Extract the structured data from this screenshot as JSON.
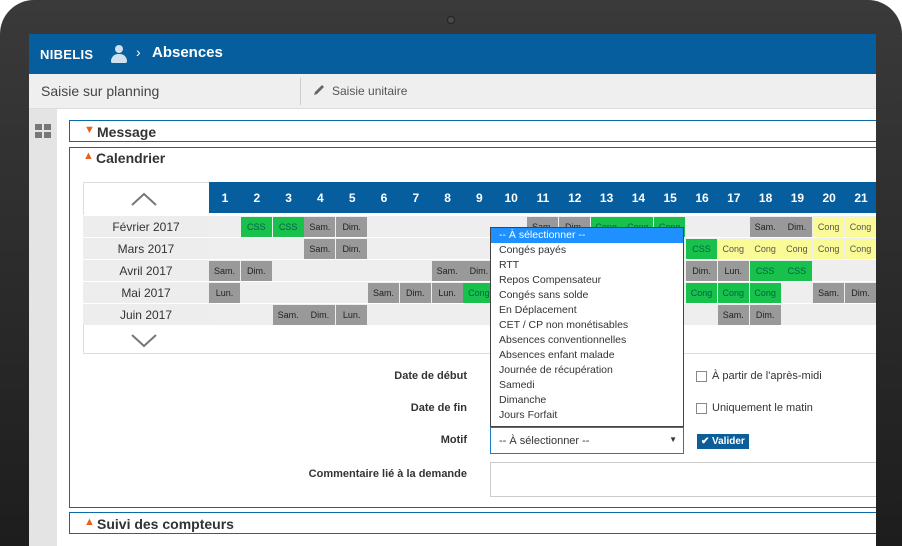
{
  "header": {
    "logo": "NIBELIS",
    "title": "Absences",
    "crumb_sep": "›"
  },
  "subbar": {
    "title": "Saisie sur planning",
    "tab_label": "Saisie unitaire"
  },
  "panels": {
    "message": "Message",
    "calendrier": "Calendrier",
    "suivi": "Suivi des compteurs"
  },
  "calendar": {
    "days": [
      "1",
      "2",
      "3",
      "4",
      "5",
      "6",
      "7",
      "8",
      "9",
      "10",
      "11",
      "12",
      "13",
      "14",
      "15",
      "16",
      "17",
      "18",
      "19",
      "20",
      "21"
    ],
    "months": [
      {
        "label": "Février 2017",
        "cells": [
          {
            "day": 2,
            "text": "CSS",
            "kind": "green"
          },
          {
            "day": 3,
            "text": "CSS",
            "kind": "green"
          },
          {
            "day": 4,
            "text": "Sam.",
            "kind": "gray"
          },
          {
            "day": 5,
            "text": "Dim.",
            "kind": "gray"
          },
          {
            "day": 11,
            "text": "Sam.",
            "kind": "gray"
          },
          {
            "day": 12,
            "text": "Dim.",
            "kind": "gray"
          },
          {
            "day": 13,
            "text": "Cong",
            "kind": "green"
          },
          {
            "day": 14,
            "text": "Cong",
            "kind": "green"
          },
          {
            "day": 15,
            "text": "Cong",
            "kind": "green"
          },
          {
            "day": 18,
            "text": "Sam.",
            "kind": "gray"
          },
          {
            "day": 19,
            "text": "Dim.",
            "kind": "gray"
          },
          {
            "day": 20,
            "text": "Cong",
            "kind": "yellow"
          },
          {
            "day": 21,
            "text": "Cong",
            "kind": "yellow"
          }
        ]
      },
      {
        "label": "Mars 2017",
        "cells": [
          {
            "day": 4,
            "text": "Sam.",
            "kind": "gray"
          },
          {
            "day": 5,
            "text": "Dim.",
            "kind": "gray"
          },
          {
            "day": 16,
            "text": "CSS",
            "kind": "green"
          },
          {
            "day": 17,
            "text": "Cong",
            "kind": "yellow"
          },
          {
            "day": 18,
            "text": "Cong",
            "kind": "yellow"
          },
          {
            "day": 19,
            "text": "Cong",
            "kind": "yellow"
          },
          {
            "day": 20,
            "text": "Cong",
            "kind": "yellow"
          },
          {
            "day": 21,
            "text": "Cong",
            "kind": "yellow"
          }
        ]
      },
      {
        "label": "Avril 2017",
        "cells": [
          {
            "day": 1,
            "text": "Sam.",
            "kind": "gray"
          },
          {
            "day": 2,
            "text": "Dim.",
            "kind": "gray"
          },
          {
            "day": 8,
            "text": "Sam.",
            "kind": "gray"
          },
          {
            "day": 9,
            "text": "Dim.",
            "kind": "gray"
          },
          {
            "day": 16,
            "text": "Dim.",
            "kind": "gray"
          },
          {
            "day": 17,
            "text": "Lun.",
            "kind": "gray"
          },
          {
            "day": 18,
            "text": "CSS",
            "kind": "green"
          },
          {
            "day": 19,
            "text": "CSS",
            "kind": "green"
          }
        ]
      },
      {
        "label": "Mai 2017",
        "cells": [
          {
            "day": 1,
            "text": "Lun.",
            "kind": "gray"
          },
          {
            "day": 6,
            "text": "Sam.",
            "kind": "gray"
          },
          {
            "day": 7,
            "text": "Dim.",
            "kind": "gray"
          },
          {
            "day": 8,
            "text": "Lun.",
            "kind": "gray"
          },
          {
            "day": 9,
            "text": "Cong",
            "kind": "green"
          },
          {
            "day": 16,
            "text": "Cong",
            "kind": "green"
          },
          {
            "day": 17,
            "text": "Cong",
            "kind": "green"
          },
          {
            "day": 18,
            "text": "Cong",
            "kind": "green"
          },
          {
            "day": 20,
            "text": "Sam.",
            "kind": "gray"
          },
          {
            "day": 21,
            "text": "Dim.",
            "kind": "gray"
          }
        ]
      },
      {
        "label": "Juin 2017",
        "cells": [
          {
            "day": 3,
            "text": "Sam.",
            "kind": "gray"
          },
          {
            "day": 4,
            "text": "Dim.",
            "kind": "gray"
          },
          {
            "day": 5,
            "text": "Lun.",
            "kind": "gray"
          },
          {
            "day": 17,
            "text": "Sam.",
            "kind": "gray"
          },
          {
            "day": 18,
            "text": "Dim.",
            "kind": "gray"
          }
        ]
      }
    ]
  },
  "form": {
    "date_debut_label": "Date de début",
    "date_fin_label": "Date de fin",
    "motif_label": "Motif",
    "commentaire_label": "Commentaire lié à la demande",
    "apres_midi_label": "À partir de l'après-midi",
    "matin_label": "Uniquement le matin",
    "motif_value": "-- À sélectionner --",
    "valider_label": "Valider"
  },
  "dropdown": {
    "options": [
      "-- À sélectionner --",
      "Congés payés",
      "RTT",
      "Repos Compensateur",
      "Congés sans solde",
      "En Déplacement",
      "CET / CP non monétisables",
      "Absences conventionnelles",
      "Absences enfant malade",
      "Journée de récupération",
      "Samedi",
      "Dimanche",
      "Jours Forfait"
    ],
    "selected_index": 0
  },
  "colors": {
    "brand": "#075e9e",
    "accent": "#e8601c",
    "green": "#18c04c",
    "yellow": "#fafa96",
    "gray": "#999999"
  }
}
